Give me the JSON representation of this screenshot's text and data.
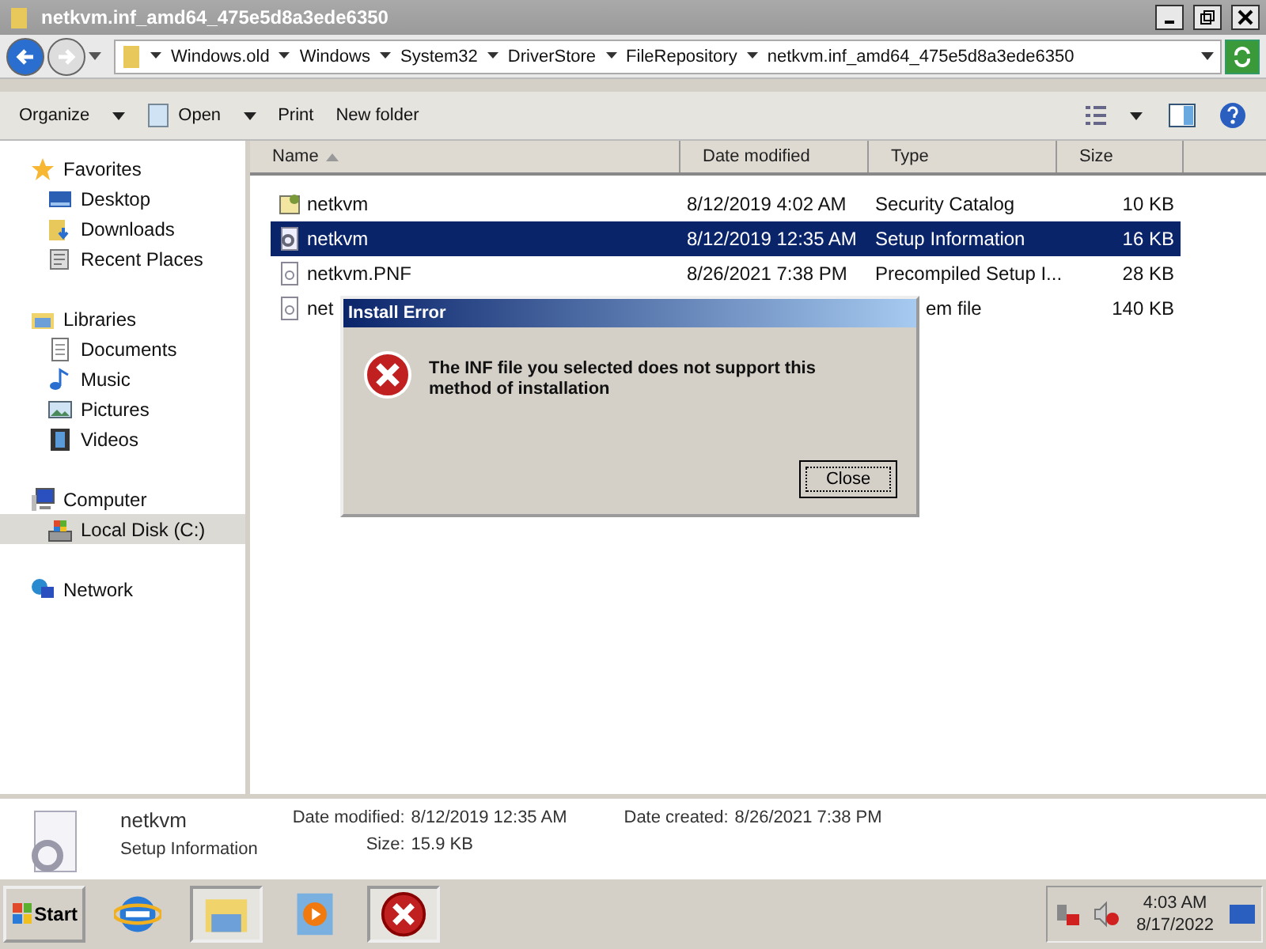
{
  "window": {
    "title": "netkvm.inf_amd64_475e5d8a3ede6350"
  },
  "address": {
    "crumbs": [
      "Windows.old",
      "Windows",
      "System32",
      "DriverStore",
      "FileRepository",
      "netkvm.inf_amd64_475e5d8a3ede6350"
    ]
  },
  "toolbar": {
    "items": [
      {
        "label": "Organize",
        "kind": "menu"
      },
      {
        "label": "Open",
        "kind": "open"
      },
      {
        "label": "Print",
        "kind": "plain"
      },
      {
        "label": "New folder",
        "kind": "plain"
      }
    ]
  },
  "sidebar": {
    "groups": [
      {
        "label": "Favorites",
        "kind": "star",
        "selected": false,
        "children": [
          {
            "label": "Desktop",
            "kind": "desktop",
            "selected": false
          },
          {
            "label": "Downloads",
            "kind": "downloads",
            "selected": false
          },
          {
            "label": "Recent Places",
            "kind": "recent",
            "selected": false
          }
        ]
      },
      {
        "label": "Libraries",
        "kind": "libraries",
        "selected": false,
        "children": [
          {
            "label": "Documents",
            "kind": "documents",
            "selected": false
          },
          {
            "label": "Music",
            "kind": "music",
            "selected": false
          },
          {
            "label": "Pictures",
            "kind": "pictures",
            "selected": false
          },
          {
            "label": "Videos",
            "kind": "videos",
            "selected": false
          }
        ]
      },
      {
        "label": "Computer",
        "kind": "computer",
        "selected": false,
        "children": [
          {
            "label": "Local Disk (C:)",
            "kind": "disk",
            "selected": true
          }
        ]
      },
      {
        "label": "Network",
        "kind": "network",
        "selected": false
      }
    ]
  },
  "table": {
    "columns": [
      "Name",
      "Date modified",
      "Type",
      "Size"
    ],
    "rows": [
      {
        "name": "netkvm",
        "date": "8/12/2019 4:02 AM",
        "type": "Security Catalog",
        "size": "10 KB",
        "kind": "catalog",
        "selected": false
      },
      {
        "name": "netkvm",
        "date": "8/12/2019 12:35 AM",
        "type": "Setup Information",
        "size": "16 KB",
        "kind": "setup",
        "selected": true
      },
      {
        "name": "netkvm.PNF",
        "date": "8/26/2021 7:38 PM",
        "type": "Precompiled Setup I...",
        "size": "28 KB",
        "kind": "file",
        "selected": false
      },
      {
        "name": "net",
        "type": "em file",
        "size": "140 KB",
        "kind": "file",
        "selected": false
      }
    ]
  },
  "dialog": {
    "title": "Install Error",
    "message": "The INF file you selected does not support this method of installation",
    "button": "Close"
  },
  "details": {
    "name": "netkvm",
    "type": "Setup Information",
    "fields": [
      {
        "label": "Date modified:",
        "value": "8/12/2019 12:35 AM"
      },
      {
        "label": "Date created:",
        "value": "8/26/2021 7:38 PM"
      },
      {
        "label": "Size:",
        "value": "15.9 KB"
      }
    ]
  },
  "taskbar": {
    "start": "Start",
    "apps": [
      {
        "kind": "ie",
        "selected": false
      },
      {
        "kind": "explorer",
        "selected": true
      },
      {
        "kind": "media",
        "selected": false
      },
      {
        "kind": "error",
        "selected": true
      }
    ],
    "time": "4:03 AM",
    "date": "8/17/2022"
  }
}
